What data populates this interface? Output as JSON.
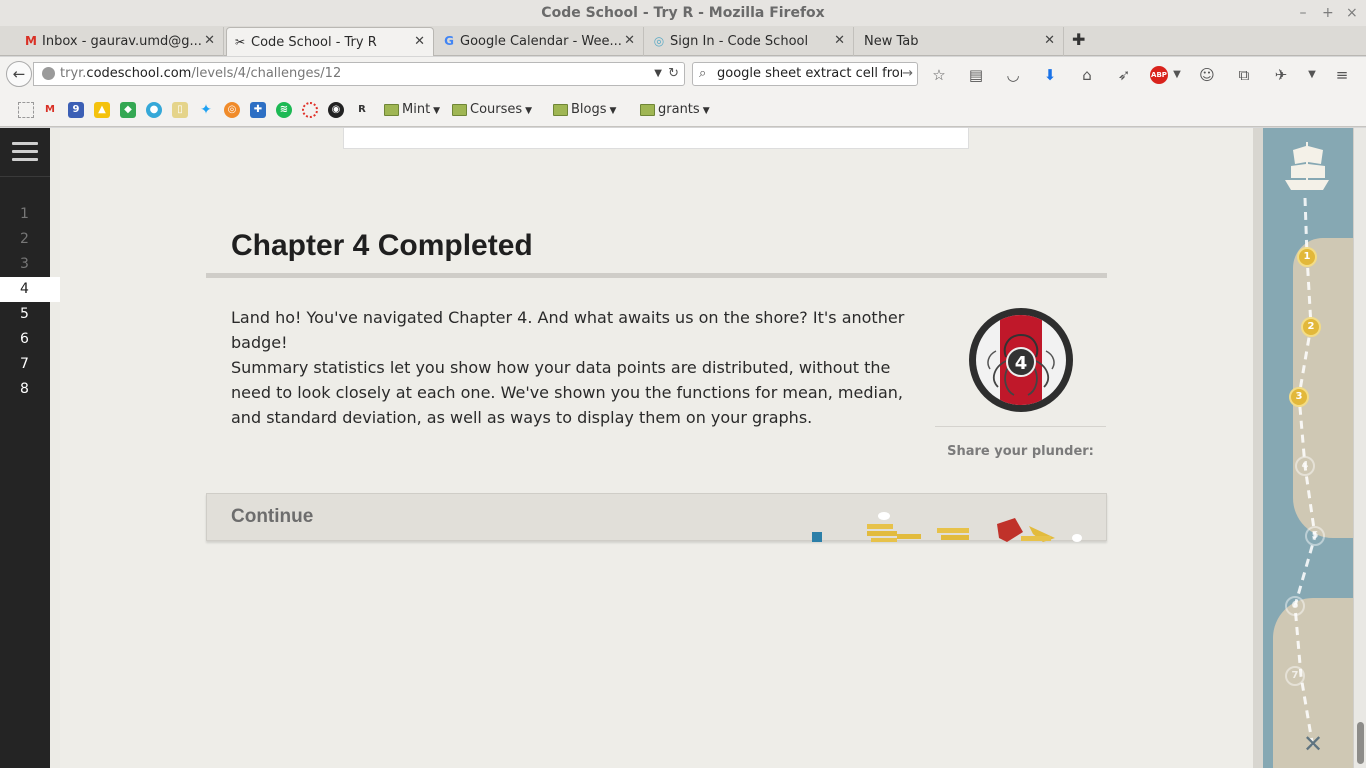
{
  "window": {
    "title": "Code School - Try R - Mozilla Firefox"
  },
  "tabs": [
    {
      "label": "Inbox - gaurav.umd@g...",
      "icon": "gmail-icon"
    },
    {
      "label": "Code School - Try R",
      "icon": "codeschool-tools-icon",
      "active": true
    },
    {
      "label": "Google Calendar - Wee...",
      "icon": "google-icon"
    },
    {
      "label": "Sign In - Code School",
      "icon": "codeschool-circle-icon"
    },
    {
      "label": "New Tab",
      "icon": ""
    }
  ],
  "nav": {
    "url_prefix": "tryr.",
    "url_host": "codeschool.com",
    "url_path": "/levels/4/challenges/12",
    "search_value": "google sheet extract cell from"
  },
  "bookmarks": {
    "folders": [
      "Mint",
      "Courses",
      "Blogs",
      "grants"
    ]
  },
  "sidebar": {
    "levels": [
      "1",
      "2",
      "3",
      "4",
      "5",
      "6",
      "7",
      "8"
    ],
    "current_level": "4"
  },
  "main": {
    "title": "Chapter 4 Completed",
    "paragraph1": "Land ho! You've navigated Chapter 4. And what awaits us on the shore? It's another badge!",
    "paragraph2": "Summary statistics let you show how your data points are distributed, without the need to look closely at each one. We've shown you the functions for mean, median, and standard deviation, as well as ways to display them on your graphs.",
    "badge_number": "4",
    "share_label": "Share your plunder:",
    "continue_label": "Continue"
  },
  "map": {
    "markers": [
      "1",
      "2",
      "3",
      "4",
      "5",
      "6",
      "7"
    ],
    "completed_count": 3
  },
  "colors": {
    "badge_red": "#c0182a",
    "marker_gold": "#e2b83a",
    "sea": "#86a8b3",
    "rail": "#242424"
  }
}
